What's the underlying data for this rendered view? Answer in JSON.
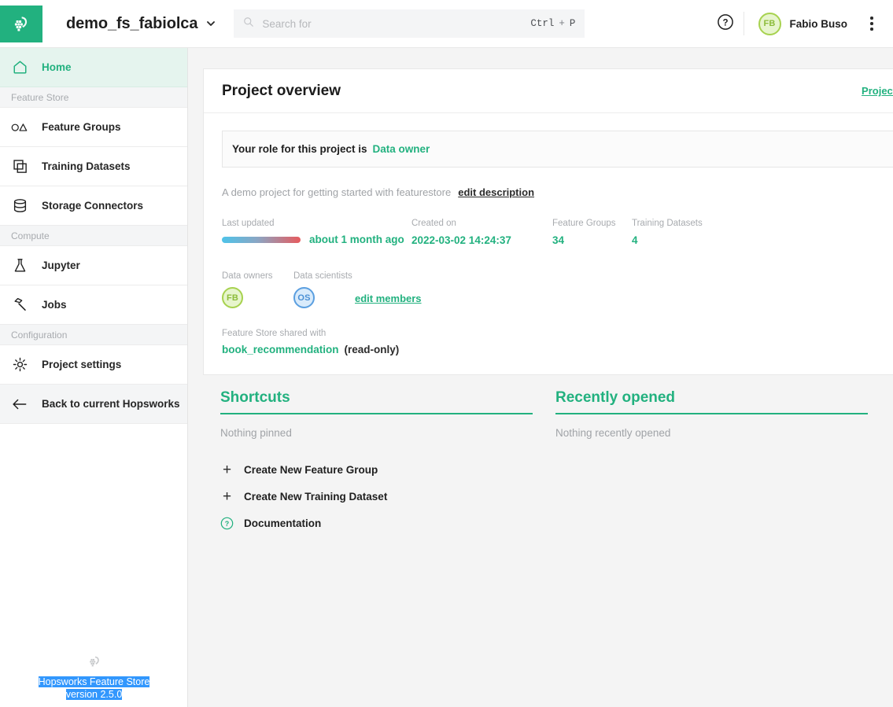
{
  "brand": {
    "accent": "#22b17f",
    "logo_icon": "hopsworks-logo-icon",
    "footer_logo_icon": "hopsworks-glyph-icon"
  },
  "topbar": {
    "project_name": "demo_fs_fabiolca",
    "project_chevron_icon": "chevron-down-icon",
    "search": {
      "icon": "search-icon",
      "placeholder": "Search for",
      "shortcut_mod": "Ctrl",
      "shortcut_plus": "+",
      "shortcut_key": "P"
    },
    "help_icon": "question-circle-icon",
    "user": {
      "initials": "FB",
      "name": "Fabio Buso"
    },
    "overflow_icon": "kebab-menu-icon"
  },
  "sidebar": {
    "home": {
      "label": "Home",
      "icon": "home-icon"
    },
    "sections": [
      {
        "label": "Feature Store",
        "items": [
          {
            "label": "Feature Groups",
            "icon": "circle-triangle-icon"
          },
          {
            "label": "Training Datasets",
            "icon": "stacked-squares-icon"
          },
          {
            "label": "Storage Connectors",
            "icon": "database-icon"
          }
        ]
      },
      {
        "label": "Compute",
        "items": [
          {
            "label": "Jupyter",
            "icon": "flask-icon"
          },
          {
            "label": "Jobs",
            "icon": "hammer-icon"
          }
        ]
      },
      {
        "label": "Configuration",
        "items": [
          {
            "label": "Project settings",
            "icon": "gear-icon"
          },
          {
            "label": "Back to current Hopsworks",
            "icon": "arrow-left-icon"
          }
        ]
      }
    ],
    "footer": {
      "line1": "Hopsworks Feature Store",
      "line2": "version 2.5.0"
    }
  },
  "overview": {
    "title": "Project overview",
    "settings_link": "Project Settings",
    "role_label": "Your role for this project is",
    "role_value": "Data owner",
    "description": "A demo project for getting started with featurestore",
    "edit_description_link": "edit description",
    "stats": {
      "last_updated_label": "Last updated",
      "last_updated_value": "about 1 month ago",
      "created_on_label": "Created on",
      "created_on_value": "2022-03-02 14:24:37",
      "feature_groups_label": "Feature Groups",
      "feature_groups_value": "34",
      "training_datasets_label": "Training Datasets",
      "training_datasets_value": "4"
    },
    "members": {
      "owners_label": "Data owners",
      "owners": [
        {
          "initials": "FB"
        }
      ],
      "scientists_label": "Data scientists",
      "scientists": [
        {
          "initials": "OS"
        }
      ],
      "edit_members_link": "edit members"
    },
    "shared": {
      "label": "Feature Store shared with",
      "project": "book_recommendation",
      "access": "(read-only)"
    }
  },
  "panels": {
    "shortcuts": {
      "title": "Shortcuts",
      "empty": "Nothing pinned",
      "actions": [
        {
          "label": "Create New Feature Group",
          "icon": "plus-icon"
        },
        {
          "label": "Create New Training Dataset",
          "icon": "plus-icon"
        },
        {
          "label": "Documentation",
          "icon": "question-circle-green-icon"
        }
      ]
    },
    "recent": {
      "title": "Recently opened",
      "empty": "Nothing recently opened"
    }
  }
}
